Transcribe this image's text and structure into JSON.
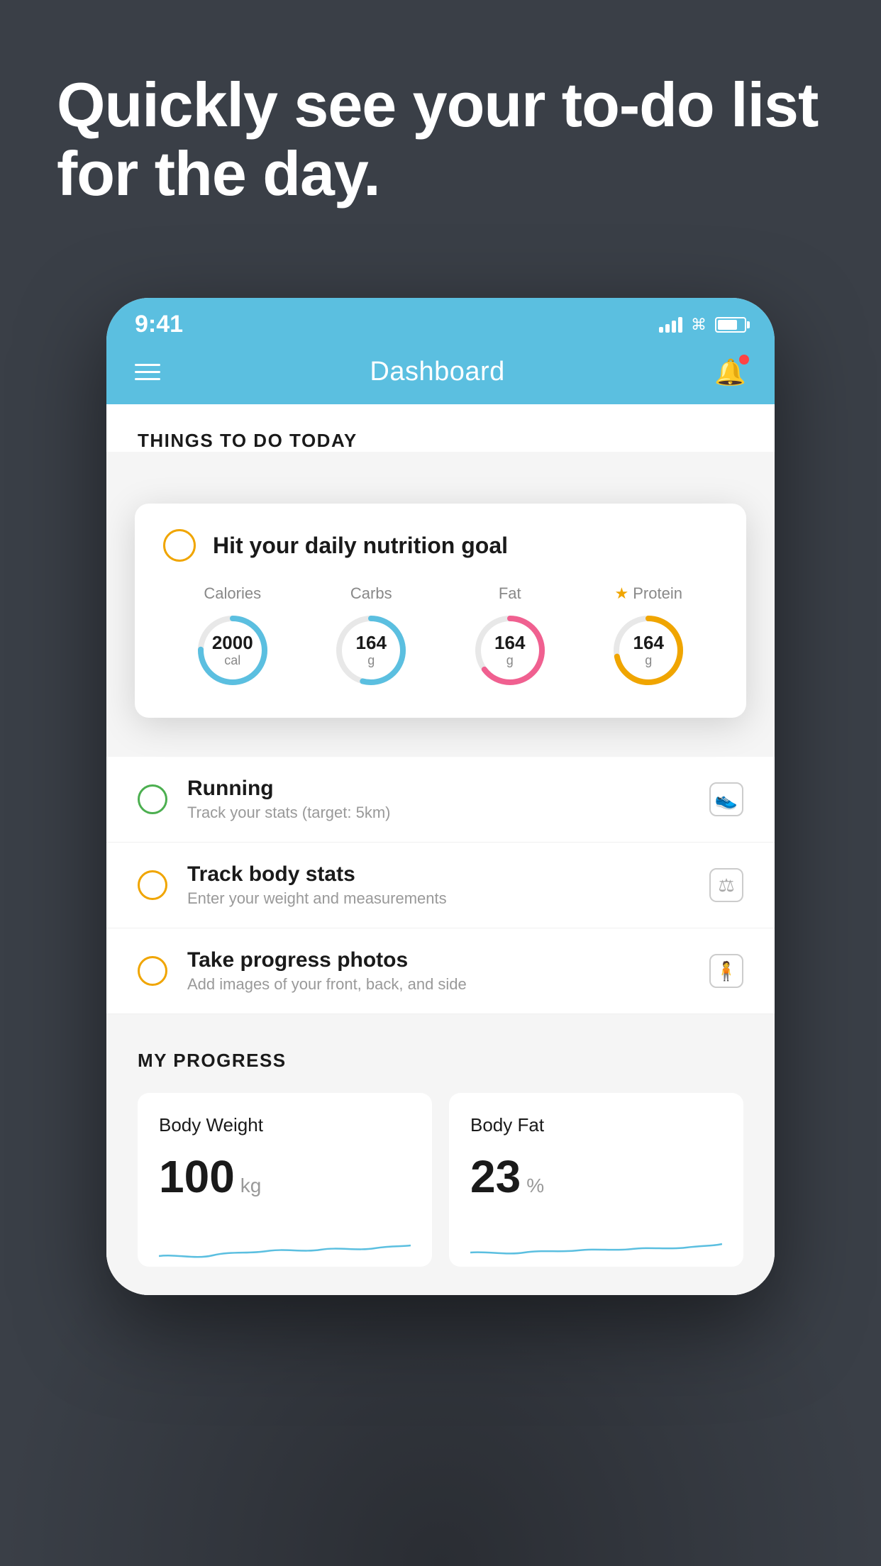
{
  "hero": {
    "headline": "Quickly see your to-do list for the day."
  },
  "status_bar": {
    "time": "9:41",
    "signal": "signal-icon",
    "wifi": "wifi-icon",
    "battery": "battery-icon"
  },
  "navbar": {
    "title": "Dashboard",
    "menu_label": "menu-icon",
    "bell_label": "bell-icon"
  },
  "things_section": {
    "title": "THINGS TO DO TODAY"
  },
  "floating_card": {
    "checkbox_label": "unchecked-circle",
    "title": "Hit your daily nutrition goal",
    "nutrition": [
      {
        "label": "Calories",
        "value": "2000",
        "unit": "cal",
        "type": "blue",
        "star": false
      },
      {
        "label": "Carbs",
        "value": "164",
        "unit": "g",
        "type": "blue",
        "star": false
      },
      {
        "label": "Fat",
        "value": "164",
        "unit": "g",
        "type": "pink",
        "star": false
      },
      {
        "label": "Protein",
        "value": "164",
        "unit": "g",
        "type": "yellow",
        "star": true
      }
    ]
  },
  "todo_items": [
    {
      "name": "Running",
      "description": "Track your stats (target: 5km)",
      "circle_color": "green",
      "icon": "shoe-icon"
    },
    {
      "name": "Track body stats",
      "description": "Enter your weight and measurements",
      "circle_color": "yellow",
      "icon": "scale-icon"
    },
    {
      "name": "Take progress photos",
      "description": "Add images of your front, back, and side",
      "circle_color": "yellow",
      "icon": "person-icon"
    }
  ],
  "progress_section": {
    "title": "MY PROGRESS",
    "cards": [
      {
        "title": "Body Weight",
        "value": "100",
        "unit": "kg"
      },
      {
        "title": "Body Fat",
        "value": "23",
        "unit": "%"
      }
    ]
  }
}
